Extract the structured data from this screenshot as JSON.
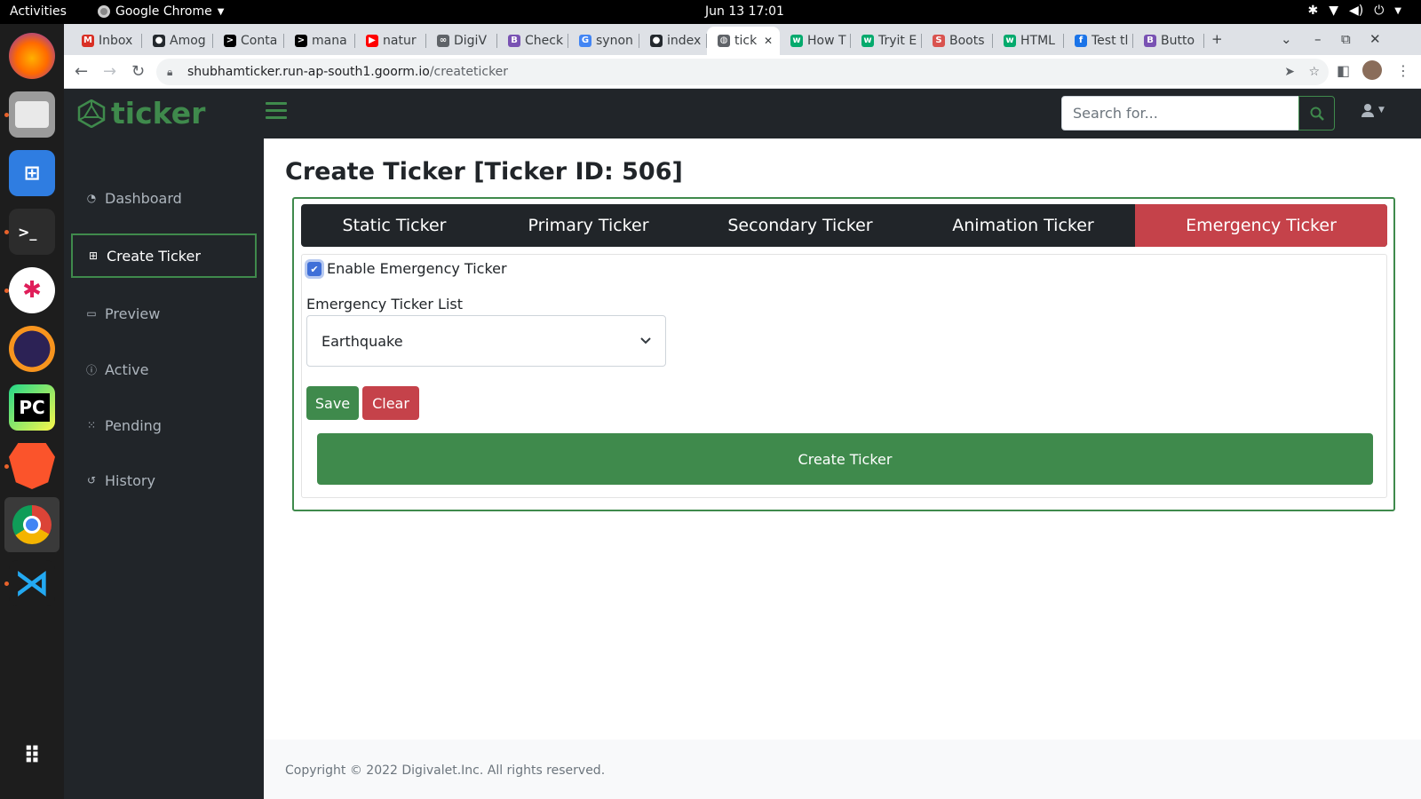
{
  "system": {
    "activities": "Activities",
    "app_name": "Google Chrome",
    "clock": "Jun 13  17:01"
  },
  "browser": {
    "tabs": [
      {
        "label": "Inbox",
        "icon": "gmail-icon",
        "color": "#d93025",
        "glyph": "M"
      },
      {
        "label": "Amog",
        "icon": "github-icon",
        "color": "#24292e",
        "glyph": "●"
      },
      {
        "label": "Conta",
        "icon": "terminal-icon",
        "color": "#000000",
        "glyph": ">"
      },
      {
        "label": "mana",
        "icon": "terminal-icon",
        "color": "#000000",
        "glyph": ">"
      },
      {
        "label": "natur",
        "icon": "youtube-icon",
        "color": "#ff0000",
        "glyph": "▶"
      },
      {
        "label": "DigiV",
        "icon": "link-icon",
        "color": "#5f6368",
        "glyph": "∞"
      },
      {
        "label": "Check",
        "icon": "bootstrap-icon",
        "color": "#7952b3",
        "glyph": "B"
      },
      {
        "label": "synon",
        "icon": "google-icon",
        "color": "#4285f4",
        "glyph": "G"
      },
      {
        "label": "index",
        "icon": "github-icon",
        "color": "#24292e",
        "glyph": "●"
      },
      {
        "label": "tick",
        "icon": "globe-icon",
        "color": "#5f6368",
        "glyph": "◍",
        "active": true
      },
      {
        "label": "How T",
        "icon": "w3schools-icon",
        "color": "#04aa6d",
        "glyph": "w"
      },
      {
        "label": "Tryit E",
        "icon": "w3schools-icon",
        "color": "#04aa6d",
        "glyph": "w"
      },
      {
        "label": "Boots",
        "icon": "s-icon",
        "color": "#d9534f",
        "glyph": "S"
      },
      {
        "label": "HTML",
        "icon": "w3schools-icon",
        "color": "#04aa6d",
        "glyph": "w"
      },
      {
        "label": "Test tl",
        "icon": "f-icon",
        "color": "#1a73e8",
        "glyph": "f"
      },
      {
        "label": "Butto",
        "icon": "bootstrap-icon",
        "color": "#7952b3",
        "glyph": "B"
      }
    ],
    "url_host": "shubhamticker.run-ap-south1.goorm.io",
    "url_path": "/createticker"
  },
  "app": {
    "brand": "ticker",
    "search_placeholder": "Search for...",
    "accent": "#3f8a4c",
    "danger": "#c5424a"
  },
  "sidebar": {
    "items": [
      {
        "label": "Dashboard",
        "icon": "dashboard-icon"
      },
      {
        "label": "Create Ticker",
        "icon": "plus-square-icon",
        "active": true
      },
      {
        "label": "Preview",
        "icon": "desktop-icon"
      },
      {
        "label": "Active",
        "icon": "info-icon"
      },
      {
        "label": "Pending",
        "icon": "spinner-icon"
      },
      {
        "label": "History",
        "icon": "history-icon"
      }
    ]
  },
  "main": {
    "title": "Create Ticker [Ticker ID: 506]",
    "tabs": [
      {
        "label": "Static Ticker"
      },
      {
        "label": "Primary Ticker"
      },
      {
        "label": "Secondary Ticker"
      },
      {
        "label": "Animation Ticker"
      },
      {
        "label": "Emergency Ticker",
        "active": true
      }
    ],
    "checkbox_label": "Enable Emergency Ticker",
    "checkbox_checked": true,
    "select_label": "Emergency Ticker List",
    "select_value": "Earthquake",
    "save_label": "Save",
    "clear_label": "Clear",
    "create_label": "Create Ticker"
  },
  "footer": {
    "text": "Copyright © 2022 Digivalet.Inc. All rights reserved."
  }
}
